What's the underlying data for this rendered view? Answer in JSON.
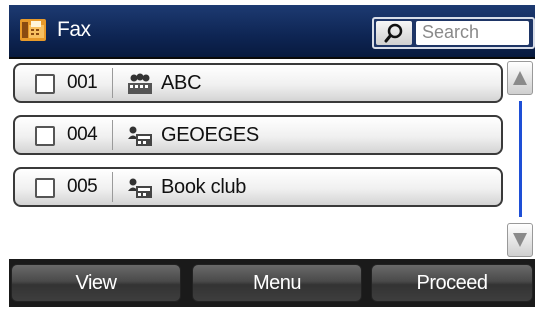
{
  "header": {
    "title": "Fax",
    "icon": "fax-icon",
    "search_placeholder": "Search"
  },
  "contacts": [
    {
      "number": "001",
      "name": "ABC",
      "type": "group-icon",
      "checked": false
    },
    {
      "number": "004",
      "name": "GEOEGES",
      "type": "contact-icon",
      "checked": false
    },
    {
      "number": "005",
      "name": "Book club",
      "type": "contact-icon",
      "checked": false
    }
  ],
  "footer": {
    "view_label": "View",
    "menu_label": "Menu",
    "proceed_label": "Proceed"
  },
  "colors": {
    "header_bg": "#0e2553",
    "accent": "#f0a020",
    "scroll_thumb": "#1e4fd6"
  }
}
